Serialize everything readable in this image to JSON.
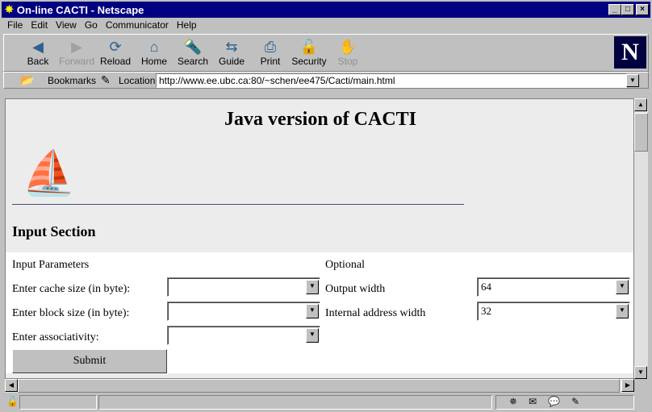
{
  "window": {
    "title": "On-line CACTI - Netscape"
  },
  "menu": [
    "File",
    "Edit",
    "View",
    "Go",
    "Communicator",
    "Help"
  ],
  "toolbar": [
    {
      "label": "Back",
      "icon": "back-arrow-icon",
      "enabled": true,
      "glyph": "◀"
    },
    {
      "label": "Forward",
      "icon": "forward-arrow-icon",
      "enabled": false,
      "glyph": "▶"
    },
    {
      "label": "Reload",
      "icon": "reload-icon",
      "enabled": true,
      "glyph": "⟳"
    },
    {
      "label": "Home",
      "icon": "home-icon",
      "enabled": true,
      "glyph": "⌂"
    },
    {
      "label": "Search",
      "icon": "search-icon",
      "enabled": true,
      "glyph": "🔦"
    },
    {
      "label": "Guide",
      "icon": "guide-icon",
      "enabled": true,
      "glyph": "⇆"
    },
    {
      "label": "Print",
      "icon": "print-icon",
      "enabled": true,
      "glyph": "⎙"
    },
    {
      "label": "Security",
      "icon": "lock-icon",
      "enabled": true,
      "glyph": "🔓"
    },
    {
      "label": "Stop",
      "icon": "stop-icon",
      "enabled": false,
      "glyph": "✋"
    }
  ],
  "location": {
    "bookmarks": "Bookmarks",
    "label": "Location:",
    "url": "http://www.ee.ubc.ca:80/~schen/ee475/Cacti/main.html"
  },
  "page": {
    "title": "Java version of CACTI",
    "section": "Input Section",
    "input_params": "Input Parameters",
    "optional": "Optional",
    "cache_size_label": "Enter cache size (in byte):",
    "cache_size": "",
    "block_size_label": "Enter block size (in byte):",
    "block_size": "",
    "assoc_label": "Enter associativity:",
    "assoc": "",
    "output_width_label": "Output width",
    "output_width": "64",
    "addr_width_label": "Internal address width",
    "addr_width": "32",
    "submit": "Submit"
  }
}
